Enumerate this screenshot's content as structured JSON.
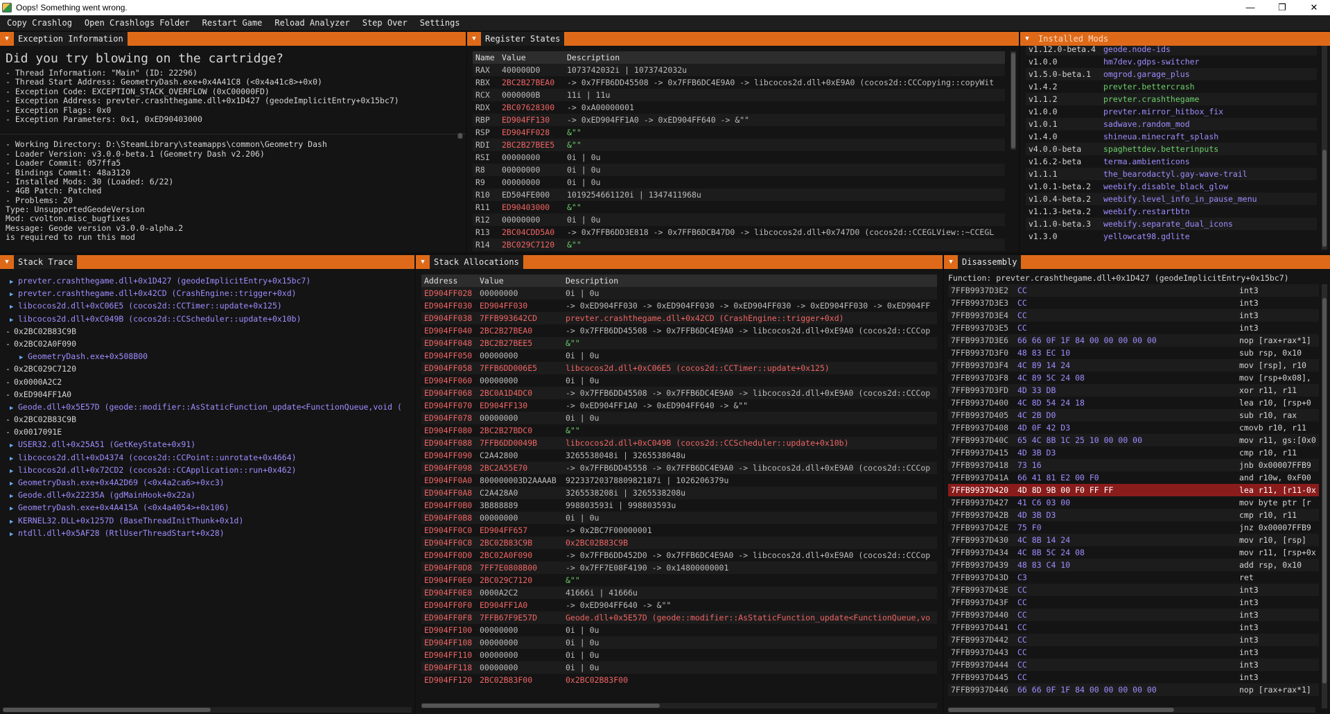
{
  "window": {
    "title": "Oops! Something went wrong.",
    "min": "—",
    "max": "❐",
    "close": "✕"
  },
  "menu": [
    "Copy Crashlog",
    "Open Crashlogs Folder",
    "Restart Game",
    "Reload Analyzer",
    "Step Over",
    "Settings"
  ],
  "exception": {
    "tab": "Exception Information",
    "headline": "Did you try blowing on the cartridge?",
    "lines": [
      "- Thread Information: \"Main\" (ID: 22296)",
      "- Thread Start Address: GeometryDash.exe+0x4A41C8 (<0x4a41c8>+0x0)",
      "- Exception Code: EXCEPTION_STACK_OVERFLOW (0xC00000FD)",
      "- Exception Address: prevter.crashthegame.dll+0x1D427 (geodeImplicitEntry+0x15bc7)",
      "- Exception Flags: 0x0",
      "- Exception Parameters: 0x1, 0xED90403000"
    ],
    "lines2": [
      "- Working Directory: D:\\SteamLibrary\\steamapps\\common\\Geometry Dash",
      "- Loader Version: v3.0.0-beta.1 (Geometry Dash v2.206)",
      "- Loader Commit: 057ffa5",
      "- Bindings Commit: 48a3120",
      "- Installed Mods: 30 (Loaded: 6/22)",
      "- 4GB Patch: Patched",
      "- Problems: 20",
      "Type: UnsupportedGeodeVersion",
      "Mod: cvolton.misc_bugfixes",
      "Message: Geode version v3.0.0-alpha.2",
      "is required to run this mod"
    ]
  },
  "registers": {
    "tab": "Register States",
    "headers": [
      "Name",
      "Value",
      "Description"
    ],
    "rows": [
      {
        "n": "RAX",
        "v": "400000D0",
        "d": "1073742032i | 1073742032u",
        "vc": "gray",
        "dc": "gray"
      },
      {
        "n": "RBX",
        "v": "2BC2B27BEA0",
        "d": "-> 0x7FFB6DD45508 -> 0x7FFB6DC4E9A0 -> libcocos2d.dll+0xE9A0 (cocos2d::CCCopying::copyWit",
        "vc": "red",
        "dc": "gray"
      },
      {
        "n": "RCX",
        "v": "0000000B",
        "d": "11i | 11u",
        "vc": "gray",
        "dc": "gray"
      },
      {
        "n": "RDX",
        "v": "2BC07628300",
        "d": "-> 0xA00000001",
        "vc": "red",
        "dc": "gray"
      },
      {
        "n": "RBP",
        "v": "ED904FF130",
        "d": "-> 0xED904FF1A0 -> 0xED904FF640 -> &\"\"",
        "vc": "red",
        "dc": "gray"
      },
      {
        "n": "RSP",
        "v": "ED904FF028",
        "d": "&\"\"",
        "vc": "red",
        "dc": "grn"
      },
      {
        "n": "RDI",
        "v": "2BC2B27BEE5",
        "d": "&\"\"",
        "vc": "red",
        "dc": "grn"
      },
      {
        "n": "RSI",
        "v": "00000000",
        "d": "0i | 0u",
        "vc": "gray",
        "dc": "gray"
      },
      {
        "n": "R8",
        "v": "00000000",
        "d": "0i | 0u",
        "vc": "gray",
        "dc": "gray"
      },
      {
        "n": "R9",
        "v": "00000000",
        "d": "0i | 0u",
        "vc": "gray",
        "dc": "gray"
      },
      {
        "n": "R10",
        "v": "ED504FE000",
        "d": "1019254661120i | 1347411968u",
        "vc": "gray",
        "dc": "gray"
      },
      {
        "n": "R11",
        "v": "ED90403000",
        "d": "&\"\"",
        "vc": "red",
        "dc": "grn"
      },
      {
        "n": "R12",
        "v": "00000000",
        "d": "0i | 0u",
        "vc": "gray",
        "dc": "gray"
      },
      {
        "n": "R13",
        "v": "2BC04CDD5A0",
        "d": "-> 0x7FFB6DD3E818 -> 0x7FFB6DCB47D0 -> libcocos2d.dll+0x747D0 (cocos2d::CCEGLView::~CCEGL",
        "vc": "red",
        "dc": "gray"
      },
      {
        "n": "R14",
        "v": "2BC029C7120",
        "d": "&\"\"",
        "vc": "red",
        "dc": "grn"
      }
    ]
  },
  "mods": {
    "tab": "Installed Mods",
    "rows": [
      {
        "v": "v1.12.0-beta.4",
        "n": "geode.node-ids",
        "c": "pur"
      },
      {
        "v": "v1.0.0",
        "n": "hm7dev.gdps-switcher",
        "c": "pur"
      },
      {
        "v": "v1.5.0-beta.1",
        "n": "omgrod.garage_plus",
        "c": "pur"
      },
      {
        "v": "v1.4.2",
        "n": "prevter.bettercrash",
        "c": "grn"
      },
      {
        "v": "v1.1.2",
        "n": "prevter.crashthegame",
        "c": "grn"
      },
      {
        "v": "v1.0.0",
        "n": "prevter.mirror_hitbox_fix",
        "c": "pur"
      },
      {
        "v": "v1.0.1",
        "n": "sadwave.random_mod",
        "c": "pur"
      },
      {
        "v": "v1.4.0",
        "n": "shineua.minecraft_splash",
        "c": "pur"
      },
      {
        "v": "v4.0.0-beta",
        "n": "spaghettdev.betterinputs",
        "c": "grn"
      },
      {
        "v": "v1.6.2-beta",
        "n": "terma.ambienticons",
        "c": "pur"
      },
      {
        "v": "v1.1.1",
        "n": "the_bearodactyl.gay-wave-trail",
        "c": "pur"
      },
      {
        "v": "v1.0.1-beta.2",
        "n": "weebify.disable_black_glow",
        "c": "pur"
      },
      {
        "v": "v1.0.4-beta.2",
        "n": "weebify.level_info_in_pause_menu",
        "c": "pur"
      },
      {
        "v": "v1.1.3-beta.2",
        "n": "weebify.restartbtn",
        "c": "pur"
      },
      {
        "v": "v1.1.0-beta.3",
        "n": "weebify.separate_dual_icons",
        "c": "pur"
      },
      {
        "v": "v1.3.0",
        "n": "yellowcat98.gdlite",
        "c": "pur"
      }
    ]
  },
  "stack": {
    "tab": "Stack Trace",
    "items": [
      {
        "t": "▶",
        "s": "prevter.crashthegame.dll+0x1D427 (geodeImplicitEntry+0x15bc7)",
        "c": "pur",
        "i": 1
      },
      {
        "t": "▶",
        "s": "prevter.crashthegame.dll+0x42CD (CrashEngine::trigger+0xd)",
        "c": "pur",
        "i": 1
      },
      {
        "t": "▶",
        "s": "libcocos2d.dll+0xC06E5 (cocos2d::CCTimer::update+0x125)",
        "c": "pur",
        "i": 1
      },
      {
        "t": "▶",
        "s": "libcocos2d.dll+0xC049B (cocos2d::CCScheduler::update+0x10b)",
        "c": "pur",
        "i": 1
      },
      {
        "t": "-",
        "s": "0x2BC02B83C9B",
        "c": "",
        "i": 0
      },
      {
        "t": "-",
        "s": "0x2BC02A0F090",
        "c": "",
        "i": 0
      },
      {
        "t": "▶",
        "s": "GeometryDash.exe+0x508B00",
        "c": "pur",
        "i": 2
      },
      {
        "t": "-",
        "s": "0x2BC029C7120",
        "c": "",
        "i": 0
      },
      {
        "t": "-",
        "s": "0x0000A2C2",
        "c": "",
        "i": 0
      },
      {
        "t": "-",
        "s": "0xED904FF1A0",
        "c": "",
        "i": 0
      },
      {
        "t": "▶",
        "s": "Geode.dll+0x5E57D (geode::modifier::AsStaticFunction_update<FunctionQueue,void (",
        "c": "pur",
        "i": 1
      },
      {
        "t": "-",
        "s": "0x2BC02B83C9B",
        "c": "",
        "i": 0
      },
      {
        "t": "-",
        "s": "0x0017091E",
        "c": "",
        "i": 0
      },
      {
        "t": "▶",
        "s": "USER32.dll+0x25A51 (GetKeyState+0x91)",
        "c": "pur",
        "i": 1
      },
      {
        "t": "▶",
        "s": "libcocos2d.dll+0xD4374 (cocos2d::CCPoint::unrotate+0x4664)",
        "c": "pur",
        "i": 1
      },
      {
        "t": "▶",
        "s": "libcocos2d.dll+0x72CD2 (cocos2d::CCApplication::run+0x462)",
        "c": "pur",
        "i": 1
      },
      {
        "t": "▶",
        "s": "GeometryDash.exe+0x4A2D69 (<0x4a2ca6>+0xc3)",
        "c": "pur",
        "i": 1
      },
      {
        "t": "▶",
        "s": "Geode.dll+0x22235A (gdMainHook+0x22a)",
        "c": "pur",
        "i": 1
      },
      {
        "t": "▶",
        "s": "GeometryDash.exe+0x4A415A (<0x4a4054>+0x106)",
        "c": "pur",
        "i": 1
      },
      {
        "t": "▶",
        "s": "KERNEL32.DLL+0x1257D (BaseThreadInitThunk+0x1d)",
        "c": "pur",
        "i": 1
      },
      {
        "t": "▶",
        "s": "ntdll.dll+0x5AF28 (RtlUserThreadStart+0x28)",
        "c": "pur",
        "i": 1
      }
    ]
  },
  "allocs": {
    "tab": "Stack Allocations",
    "headers": [
      "Address",
      "Value",
      "Description"
    ],
    "rows": [
      {
        "a": "ED904FF028",
        "v": "00000000",
        "d": "0i | 0u",
        "vc": "gray",
        "dc": "gray"
      },
      {
        "a": "ED904FF030",
        "v": "ED904FF030",
        "d": "-> 0xED904FF030 -> 0xED904FF030 -> 0xED904FF030 -> 0xED904FF030 -> 0xED904FF",
        "vc": "red",
        "dc": "gray"
      },
      {
        "a": "ED904FF038",
        "v": "7FFB993642CD",
        "d": "prevter.crashthegame.dll+0x42CD (CrashEngine::trigger+0xd)",
        "vc": "red",
        "dc": "red"
      },
      {
        "a": "ED904FF040",
        "v": "2BC2B27BEA0",
        "d": "-> 0x7FFB6DD45508 -> 0x7FFB6DC4E9A0 -> libcocos2d.dll+0xE9A0 (cocos2d::CCCop",
        "vc": "red",
        "dc": "gray"
      },
      {
        "a": "ED904FF048",
        "v": "2BC2B27BEE5",
        "d": "&\"\"",
        "vc": "red",
        "dc": "grn"
      },
      {
        "a": "ED904FF050",
        "v": "00000000",
        "d": "0i | 0u",
        "vc": "gray",
        "dc": "gray"
      },
      {
        "a": "ED904FF058",
        "v": "7FFB6DD006E5",
        "d": "libcocos2d.dll+0xC06E5 (cocos2d::CCTimer::update+0x125)",
        "vc": "red",
        "dc": "red"
      },
      {
        "a": "ED904FF060",
        "v": "00000000",
        "d": "0i | 0u",
        "vc": "gray",
        "dc": "gray"
      },
      {
        "a": "ED904FF068",
        "v": "2BC0A1D4DC0",
        "d": "-> 0x7FFB6DD45508 -> 0x7FFB6DC4E9A0 -> libcocos2d.dll+0xE9A0 (cocos2d::CCCop",
        "vc": "red",
        "dc": "gray"
      },
      {
        "a": "ED904FF070",
        "v": "ED904FF130",
        "d": "-> 0xED904FF1A0 -> 0xED904FF640 -> &\"\"",
        "vc": "red",
        "dc": "gray"
      },
      {
        "a": "ED904FF078",
        "v": "00000000",
        "d": "0i | 0u",
        "vc": "gray",
        "dc": "gray"
      },
      {
        "a": "ED904FF080",
        "v": "2BC2B27BDC0",
        "d": "&\"\"",
        "vc": "red",
        "dc": "grn"
      },
      {
        "a": "ED904FF088",
        "v": "7FFB6DD0049B",
        "d": "libcocos2d.dll+0xC049B (cocos2d::CCScheduler::update+0x10b)",
        "vc": "red",
        "dc": "red"
      },
      {
        "a": "ED904FF090",
        "v": "C2A42800",
        "d": "3265538048i | 3265538048u",
        "vc": "gray",
        "dc": "gray"
      },
      {
        "a": "ED904FF098",
        "v": "2BC2A55E70",
        "d": "-> 0x7FFB6DD45558 -> 0x7FFB6DC4E9A0 -> libcocos2d.dll+0xE9A0 (cocos2d::CCCop",
        "vc": "red",
        "dc": "gray"
      },
      {
        "a": "ED904FF0A0",
        "v": "800000003D2AAAAB",
        "d": "9223372037880982187i | 1026206379u",
        "vc": "gray",
        "dc": "gray"
      },
      {
        "a": "ED904FF0A8",
        "v": "C2A428A0",
        "d": "3265538208i | 3265538208u",
        "vc": "gray",
        "dc": "gray"
      },
      {
        "a": "ED904FF0B0",
        "v": "3B888889",
        "d": "998803593i | 998803593u",
        "vc": "gray",
        "dc": "gray"
      },
      {
        "a": "ED904FF0B8",
        "v": "00000000",
        "d": "0i | 0u",
        "vc": "gray",
        "dc": "gray"
      },
      {
        "a": "ED904FF0C0",
        "v": "ED904FF657",
        "d": "-> 0x2BC7F00000001",
        "vc": "red",
        "dc": "gray"
      },
      {
        "a": "ED904FF0C8",
        "v": "2BC02B83C9B",
        "d": "0x2BC02B83C9B",
        "vc": "red",
        "dc": "red"
      },
      {
        "a": "ED904FF0D0",
        "v": "2BC02A0F090",
        "d": "-> 0x7FFB6DD452D0 -> 0x7FFB6DC4E9A0 -> libcocos2d.dll+0xE9A0 (cocos2d::CCCop",
        "vc": "red",
        "dc": "gray"
      },
      {
        "a": "ED904FF0D8",
        "v": "7FF7E0808B00",
        "d": "-> 0x7FF7E08F4190 -> 0x14800000001",
        "vc": "red",
        "dc": "gray"
      },
      {
        "a": "ED904FF0E0",
        "v": "2BC029C7120",
        "d": "&\"\"",
        "vc": "red",
        "dc": "grn"
      },
      {
        "a": "ED904FF0E8",
        "v": "0000A2C2",
        "d": "41666i | 41666u",
        "vc": "gray",
        "dc": "gray"
      },
      {
        "a": "ED904FF0F0",
        "v": "ED904FF1A0",
        "d": "-> 0xED904FF640 -> &\"\"",
        "vc": "red",
        "dc": "gray"
      },
      {
        "a": "ED904FF0F8",
        "v": "7FFB67F9E57D",
        "d": "Geode.dll+0x5E57D (geode::modifier::AsStaticFunction_update<FunctionQueue,vo",
        "vc": "red",
        "dc": "red"
      },
      {
        "a": "ED904FF100",
        "v": "00000000",
        "d": "0i | 0u",
        "vc": "gray",
        "dc": "gray"
      },
      {
        "a": "ED904FF108",
        "v": "00000000",
        "d": "0i | 0u",
        "vc": "gray",
        "dc": "gray"
      },
      {
        "a": "ED904FF110",
        "v": "00000000",
        "d": "0i | 0u",
        "vc": "gray",
        "dc": "gray"
      },
      {
        "a": "ED904FF118",
        "v": "00000000",
        "d": "0i | 0u",
        "vc": "gray",
        "dc": "gray"
      },
      {
        "a": "ED904FF120",
        "v": "2BC02B83F00",
        "d": "0x2BC02B83F00",
        "vc": "red",
        "dc": "red"
      }
    ]
  },
  "disasm": {
    "tab": "Disassembly",
    "function": "Function: prevter.crashthegame.dll+0x1D427 (geodeImplicitEntry+0x15bc7)",
    "rows": [
      {
        "a": "7FFB9937D3E2",
        "b": "CC",
        "i": "int3"
      },
      {
        "a": "7FFB9937D3E3",
        "b": "CC",
        "i": "int3"
      },
      {
        "a": "7FFB9937D3E4",
        "b": "CC",
        "i": "int3"
      },
      {
        "a": "7FFB9937D3E5",
        "b": "CC",
        "i": "int3"
      },
      {
        "a": "7FFB9937D3E6",
        "b": "66 66 0F 1F 84 00 00 00 00 00",
        "i": "nop [rax+rax*1]"
      },
      {
        "a": "7FFB9937D3F0",
        "b": "48 83 EC 10",
        "i": "sub rsp, 0x10"
      },
      {
        "a": "7FFB9937D3F4",
        "b": "4C 89 14 24",
        "i": "mov [rsp], r10"
      },
      {
        "a": "7FFB9937D3F8",
        "b": "4C 89 5C 24 08",
        "i": "mov [rsp+0x08],"
      },
      {
        "a": "7FFB9937D3FD",
        "b": "4D 33 DB",
        "i": "xor r11, r11"
      },
      {
        "a": "7FFB9937D400",
        "b": "4C 8D 54 24 18",
        "i": "lea r10, [rsp+0"
      },
      {
        "a": "7FFB9937D405",
        "b": "4C 2B D0",
        "i": "sub r10, rax"
      },
      {
        "a": "7FFB9937D408",
        "b": "4D 0F 42 D3",
        "i": "cmovb r10, r11"
      },
      {
        "a": "7FFB9937D40C",
        "b": "65 4C 8B 1C 25 10 00 00 00",
        "i": "mov r11, gs:[0x0"
      },
      {
        "a": "7FFB9937D415",
        "b": "4D 3B D3",
        "i": "cmp r10, r11"
      },
      {
        "a": "7FFB9937D418",
        "b": "73 16",
        "i": "jnb 0x00007FFB9"
      },
      {
        "a": "7FFB9937D41A",
        "b": "66 41 81 E2 00 F0",
        "i": "and r10w, 0xF00"
      },
      {
        "a": "7FFB9937D420",
        "b": "4D 8D 9B 00 F0 FF FF",
        "i": "lea r11, [r11-0x",
        "hl": true
      },
      {
        "a": "7FFB9937D427",
        "b": "41 C6 03 00",
        "i": "mov byte ptr [r"
      },
      {
        "a": "7FFB9937D42B",
        "b": "4D 3B D3",
        "i": "cmp r10, r11"
      },
      {
        "a": "7FFB9937D42E",
        "b": "75 F0",
        "i": "jnz 0x00007FFB9"
      },
      {
        "a": "7FFB9937D430",
        "b": "4C 8B 14 24",
        "i": "mov r10, [rsp]"
      },
      {
        "a": "7FFB9937D434",
        "b": "4C 8B 5C 24 08",
        "i": "mov r11, [rsp+0x"
      },
      {
        "a": "7FFB9937D439",
        "b": "48 83 C4 10",
        "i": "add rsp, 0x10"
      },
      {
        "a": "7FFB9937D43D",
        "b": "C3",
        "i": "ret"
      },
      {
        "a": "7FFB9937D43E",
        "b": "CC",
        "i": "int3"
      },
      {
        "a": "7FFB9937D43F",
        "b": "CC",
        "i": "int3"
      },
      {
        "a": "7FFB9937D440",
        "b": "CC",
        "i": "int3"
      },
      {
        "a": "7FFB9937D441",
        "b": "CC",
        "i": "int3"
      },
      {
        "a": "7FFB9937D442",
        "b": "CC",
        "i": "int3"
      },
      {
        "a": "7FFB9937D443",
        "b": "CC",
        "i": "int3"
      },
      {
        "a": "7FFB9937D444",
        "b": "CC",
        "i": "int3"
      },
      {
        "a": "7FFB9937D445",
        "b": "CC",
        "i": "int3"
      },
      {
        "a": "7FFB9937D446",
        "b": "66 66 0F 1F 84 00 00 00 00 00",
        "i": "nop [rax+rax*1]"
      }
    ]
  }
}
